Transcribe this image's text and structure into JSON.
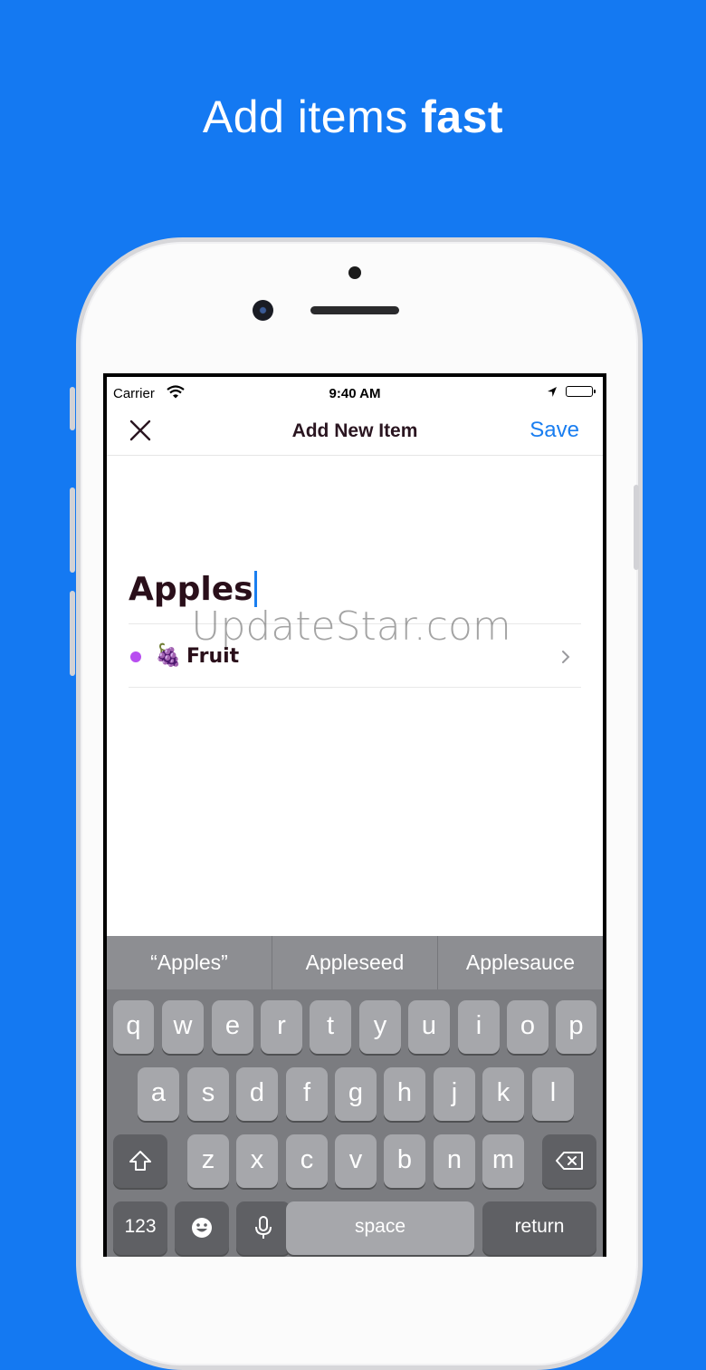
{
  "headline": {
    "regular": "Add items ",
    "bold": "fast"
  },
  "status_bar": {
    "carrier": "Carrier",
    "time": "9:40 AM"
  },
  "nav": {
    "title": "Add New Item",
    "save_label": "Save",
    "close_icon": "close-icon"
  },
  "item": {
    "name": "Apples"
  },
  "category": {
    "emoji": "🍇",
    "label": "Fruit",
    "dot_color": "#b84ef0"
  },
  "watermark": "UpdateStar.com",
  "keyboard": {
    "suggestions": [
      "“Apples”",
      "Appleseed",
      "Applesauce"
    ],
    "row1": [
      "q",
      "w",
      "e",
      "r",
      "t",
      "y",
      "u",
      "i",
      "o",
      "p"
    ],
    "row2": [
      "a",
      "s",
      "d",
      "f",
      "g",
      "h",
      "j",
      "k",
      "l"
    ],
    "row3": [
      "z",
      "x",
      "c",
      "v",
      "b",
      "n",
      "m"
    ],
    "numbers_label": "123",
    "space_label": "space",
    "return_label": "return"
  },
  "colors": {
    "background": "#1479f2",
    "accent": "#1a7ef0",
    "keyboard": "#7b7c80"
  }
}
